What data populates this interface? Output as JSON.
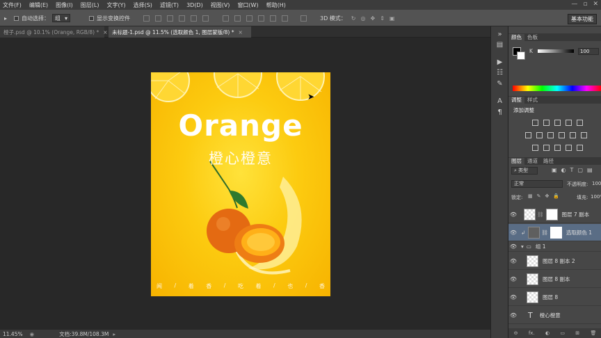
{
  "menu": [
    "文件(F)",
    "编辑(E)",
    "图像(I)",
    "图层(L)",
    "文字(Y)",
    "选择(S)",
    "滤镜(T)",
    "3D(D)",
    "视图(V)",
    "窗口(W)",
    "帮助(H)"
  ],
  "window_controls": [
    "—",
    "▫",
    "✕"
  ],
  "options": {
    "auto_select_label": "自动选择：",
    "auto_select_value": "组",
    "show_transform_label": "显示变换控件",
    "mode_3d_label": "3D 模式：",
    "workspace_label": "基本功能"
  },
  "tabs": [
    {
      "title": "橙子.psd @ 10.1% (Orange, RGB/8) *",
      "close": "×"
    },
    {
      "title": "未标题-1.psd @ 11.5% (选取颜色 1, 图层蒙版/8) *",
      "close": "×"
    }
  ],
  "poster": {
    "headline": "Orange",
    "subtitle": "橙心橙意",
    "bottom_chars": [
      "闻",
      "/",
      "着",
      "香",
      "/",
      "吃",
      "着",
      "/",
      "也",
      "/",
      "香"
    ]
  },
  "status": {
    "zoom": "11.45%",
    "doc": "文档:39.8M/108.3M"
  },
  "color_panel": {
    "tabs": [
      "颜色",
      "色板"
    ],
    "channel": "K",
    "value": "100"
  },
  "adjust_panel": {
    "tabs": [
      "调整",
      "样式"
    ],
    "title": "添加调整"
  },
  "layers_panel": {
    "tabs": [
      "图层",
      "通道",
      "路径"
    ],
    "filter": "类型",
    "blend_mode": "正常",
    "opacity_label": "不透明度:",
    "opacity_value": "100%",
    "lock_label": "锁定:",
    "fill_label": "填充:",
    "fill_value": "100%",
    "layers": [
      {
        "name": "图层 7 副本"
      },
      {
        "name": "选取颜色 1"
      },
      {
        "name": "组 1"
      },
      {
        "name": "图层 8 副本 2"
      },
      {
        "name": "图层 8 副本"
      },
      {
        "name": "图层 8"
      },
      {
        "name": "橙心橙意"
      }
    ],
    "footer": [
      "⊖",
      "fx.",
      "◐",
      "▭",
      "⊞",
      "🗑"
    ]
  },
  "colors": {
    "accent_selected": "#5a6d85",
    "poster_yellow": "#fccb10"
  }
}
